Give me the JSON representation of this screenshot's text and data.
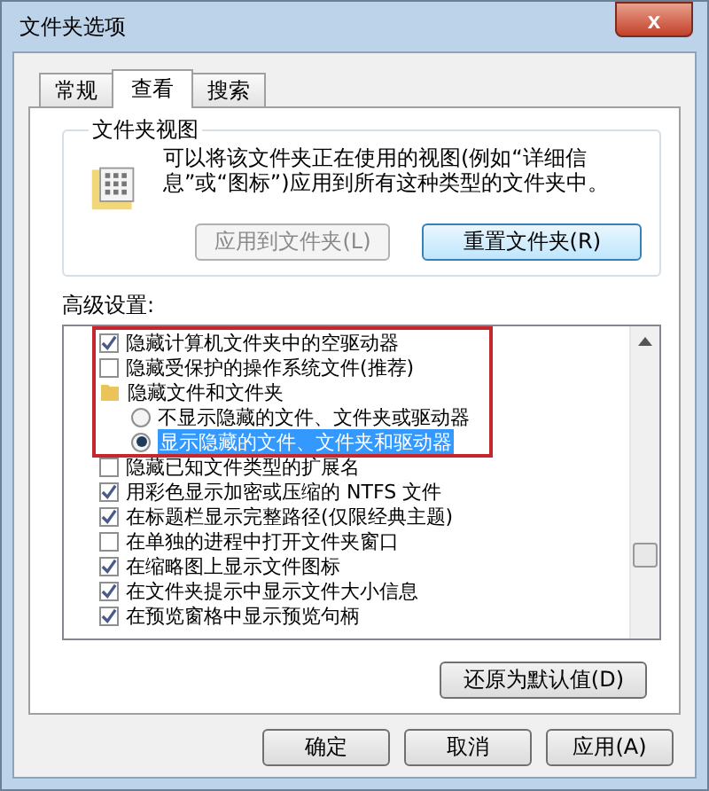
{
  "window": {
    "title": "文件夹选项",
    "close": "x"
  },
  "tabs": [
    {
      "label": "常规",
      "selected": false
    },
    {
      "label": "查看",
      "selected": true
    },
    {
      "label": "搜索",
      "selected": false
    }
  ],
  "folder_views": {
    "title": "文件夹视图",
    "description": "可以将该文件夹正在使用的视图(例如“详细信息”或“图标”)应用到所有这种类型的文件夹中。",
    "buttons": [
      {
        "label": "应用到文件夹(L)",
        "disabled": true
      },
      {
        "label": "重置文件夹(R)",
        "disabled": false
      }
    ]
  },
  "advanced": {
    "title": "高级设置:",
    "items": [
      {
        "kind": "checkbox",
        "label": "隐藏计算机文件夹中的空驱动器",
        "checked": true
      },
      {
        "kind": "checkbox",
        "label": "隐藏受保护的操作系统文件(推荐)",
        "checked": false
      },
      {
        "kind": "folder",
        "label": "隐藏文件和文件夹",
        "children": [
          {
            "kind": "radio",
            "label": "不显示隐藏的文件、文件夹或驱动器",
            "selected": false
          },
          {
            "kind": "radio",
            "label": "显示隐藏的文件、文件夹和驱动器",
            "selected": true
          }
        ]
      },
      {
        "kind": "checkbox",
        "label": "隐藏已知文件类型的扩展名",
        "checked": false
      },
      {
        "kind": "checkbox",
        "label": "用彩色显示加密或压缩的 NTFS 文件",
        "checked": true
      },
      {
        "kind": "checkbox",
        "label": "在标题栏显示完整路径(仅限经典主题)",
        "checked": true
      },
      {
        "kind": "checkbox",
        "label": "在单独的进程中打开文件夹窗口",
        "checked": false
      },
      {
        "kind": "checkbox",
        "label": "在缩略图上显示文件图标",
        "checked": true
      },
      {
        "kind": "checkbox",
        "label": "在文件夹提示中显示文件大小信息",
        "checked": true
      },
      {
        "kind": "checkbox",
        "label": "在预览窗格中显示预览句柄",
        "checked": true
      }
    ],
    "restore_button": "还原为默认值(D)"
  },
  "buttons": [
    "确定",
    "取消",
    "应用(A)"
  ]
}
